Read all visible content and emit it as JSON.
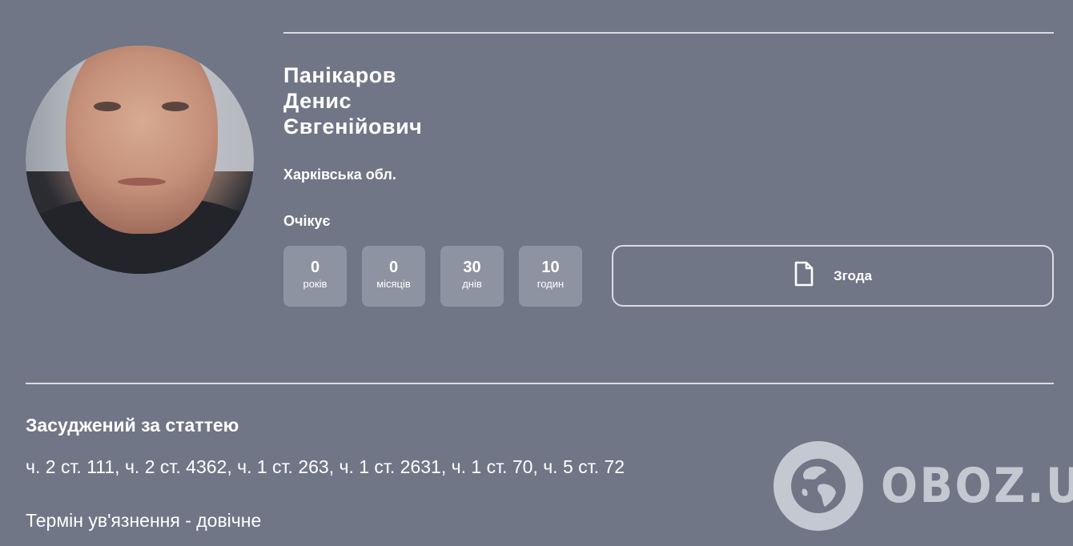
{
  "profile": {
    "surname": "Панікаров",
    "first_name": "Денис",
    "patronymic": "Євгенійович",
    "region": "Харківська обл.",
    "status": "Очікує"
  },
  "countdown": [
    {
      "value": "0",
      "unit": "років"
    },
    {
      "value": "0",
      "unit": "місяців"
    },
    {
      "value": "30",
      "unit": "днів"
    },
    {
      "value": "10",
      "unit": "годин"
    }
  ],
  "consent_button": {
    "label": "Згода",
    "icon": "document-icon"
  },
  "sentence": {
    "title": "Засуджений за статтею",
    "articles": "ч. 2 ст. 111, ч. 2 ст. 4362, ч. 1 ст. 263, ч. 1 ст. 2631, ч. 1 ст. 70, ч. 5 ст. 72",
    "term": "Термін ув'язнення  - довічне"
  },
  "watermark": {
    "text": "OBOZ.UA",
    "icon": "globe-icon"
  },
  "colors": {
    "background": "#707686",
    "counter_bg": "#8d93a1",
    "accent_line": "#d9dce2"
  }
}
